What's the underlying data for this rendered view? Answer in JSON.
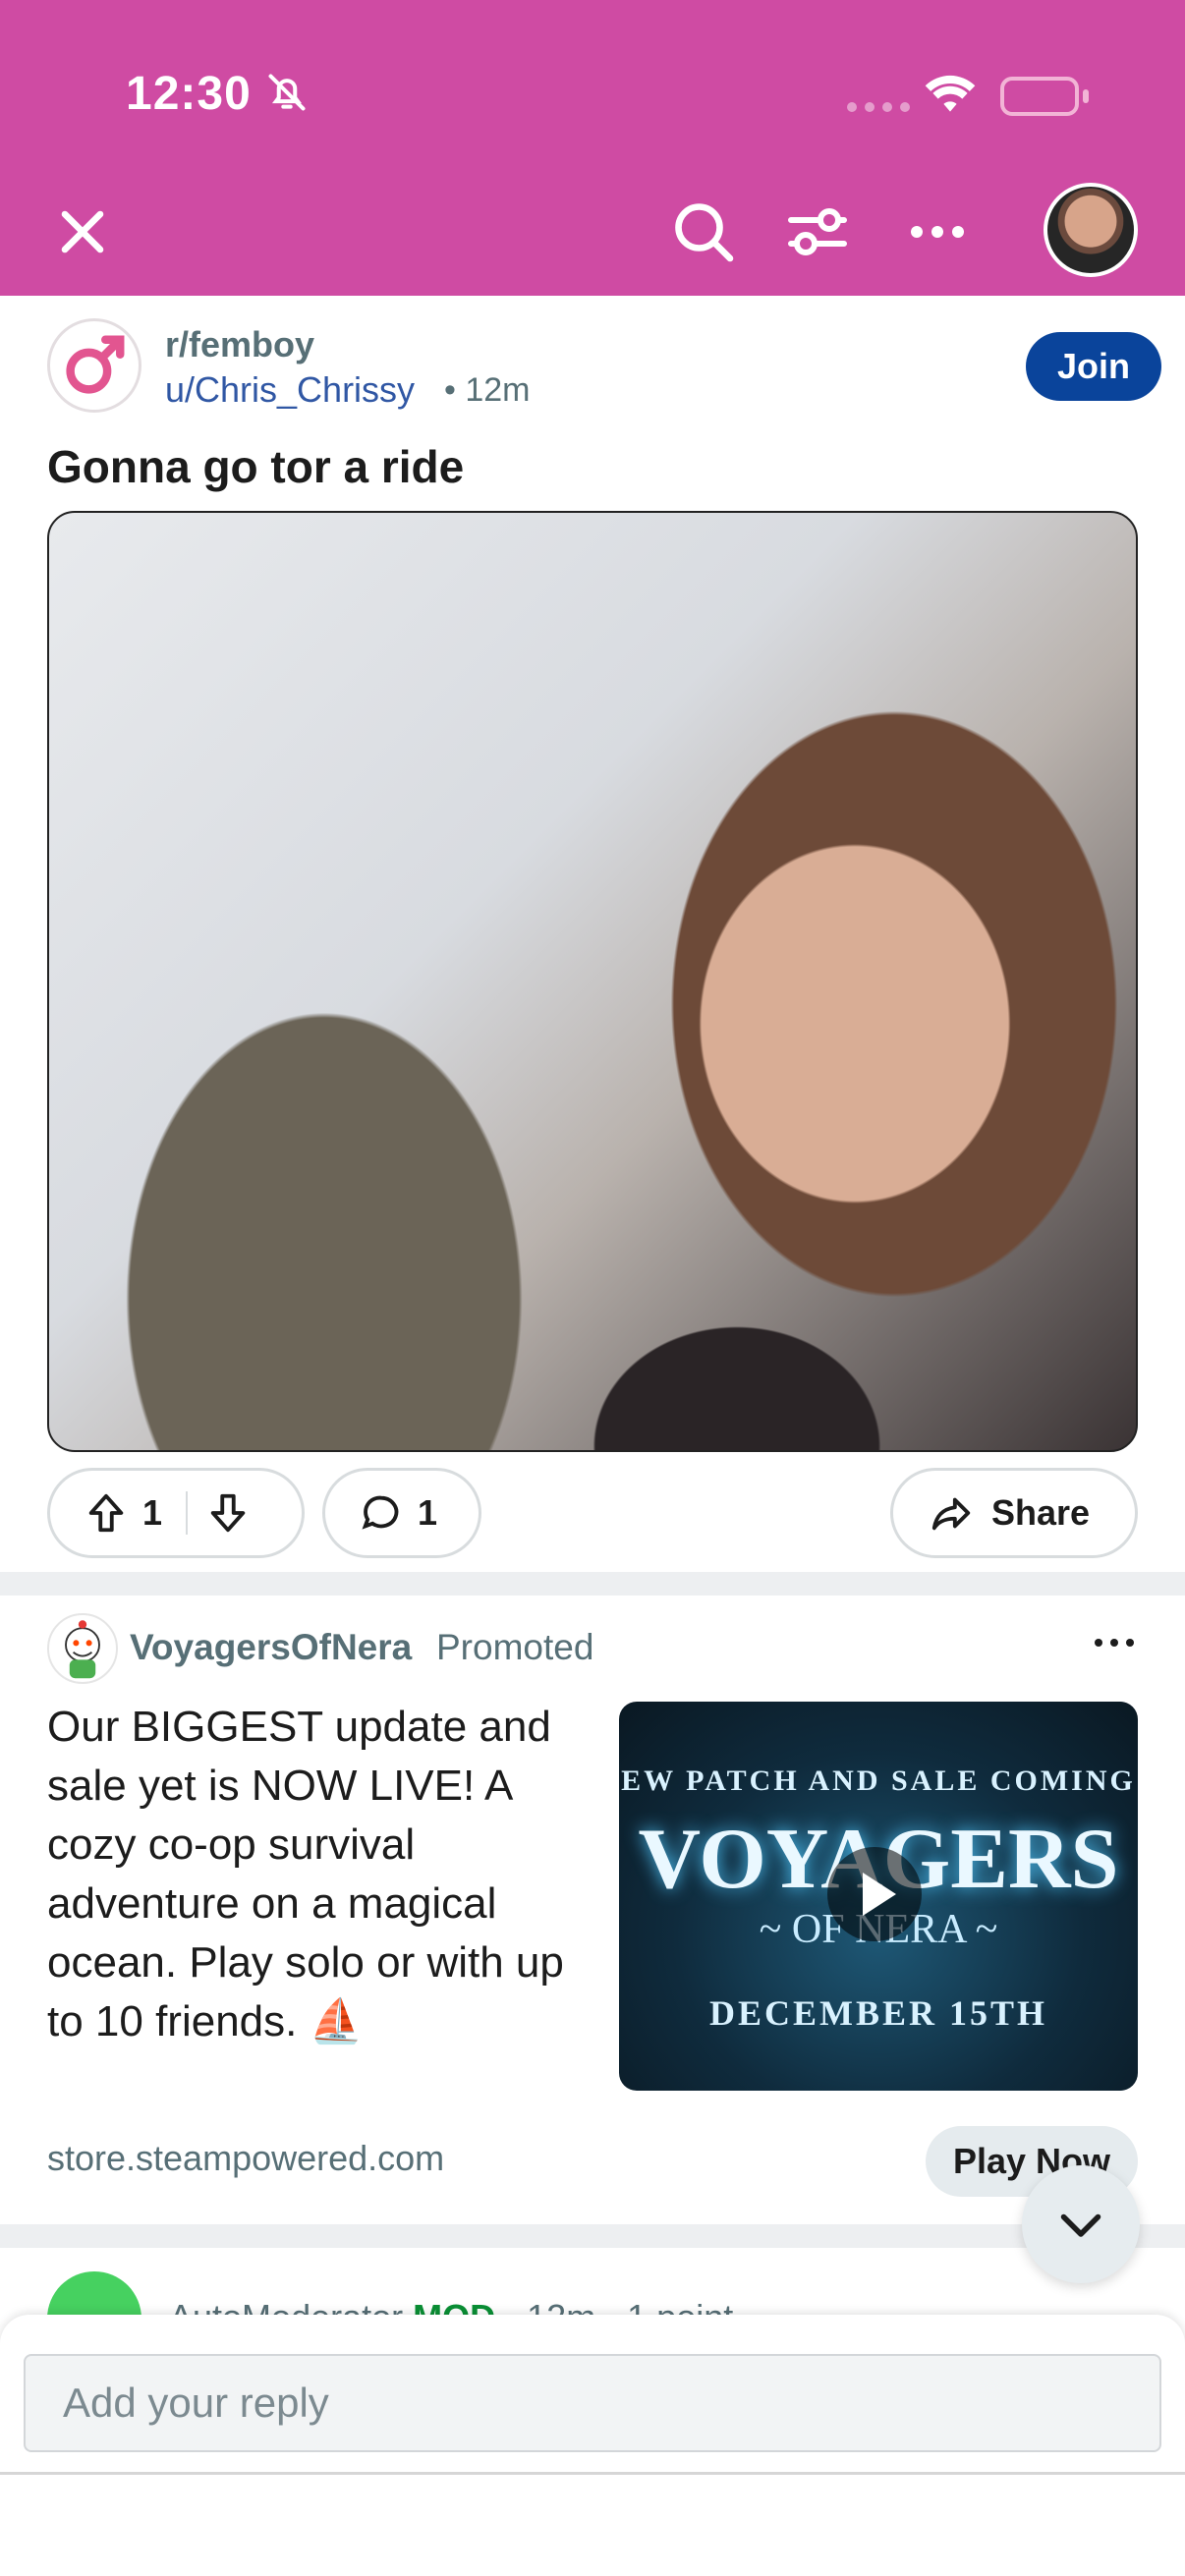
{
  "status_bar": {
    "time": "12:30"
  },
  "post": {
    "subreddit": "r/femboy",
    "author": "u/Chris_Chrissy",
    "age": "• 12m",
    "join_label": "Join",
    "title": "Gonna go tor a ride",
    "upvotes": "1",
    "comments": "1",
    "share_label": "Share"
  },
  "ad": {
    "advertiser": "VoyagersOfNera",
    "promoted_label": "Promoted",
    "body": "Our BIGGEST update and sale yet is NOW LIVE! A cozy co-op survival adventure on a magical ocean. Play solo or with up to 10 friends. ⛵",
    "thumb": {
      "line1": "EW PATCH AND SALE COMING",
      "line2": "VOYAGERS",
      "line3": "~ OF NERA ~",
      "line4": "DECEMBER 15TH"
    },
    "domain": "store.steampowered.com",
    "cta": "Play Now"
  },
  "comment_peek": {
    "author": "AutoModerator",
    "badge": "MOD",
    "meta": "· 12m · 1 point"
  },
  "reply": {
    "placeholder": "Add your reply"
  },
  "colors": {
    "header": "#cf4ba3",
    "join": "#0a449b",
    "mod": "#0a8f35"
  }
}
